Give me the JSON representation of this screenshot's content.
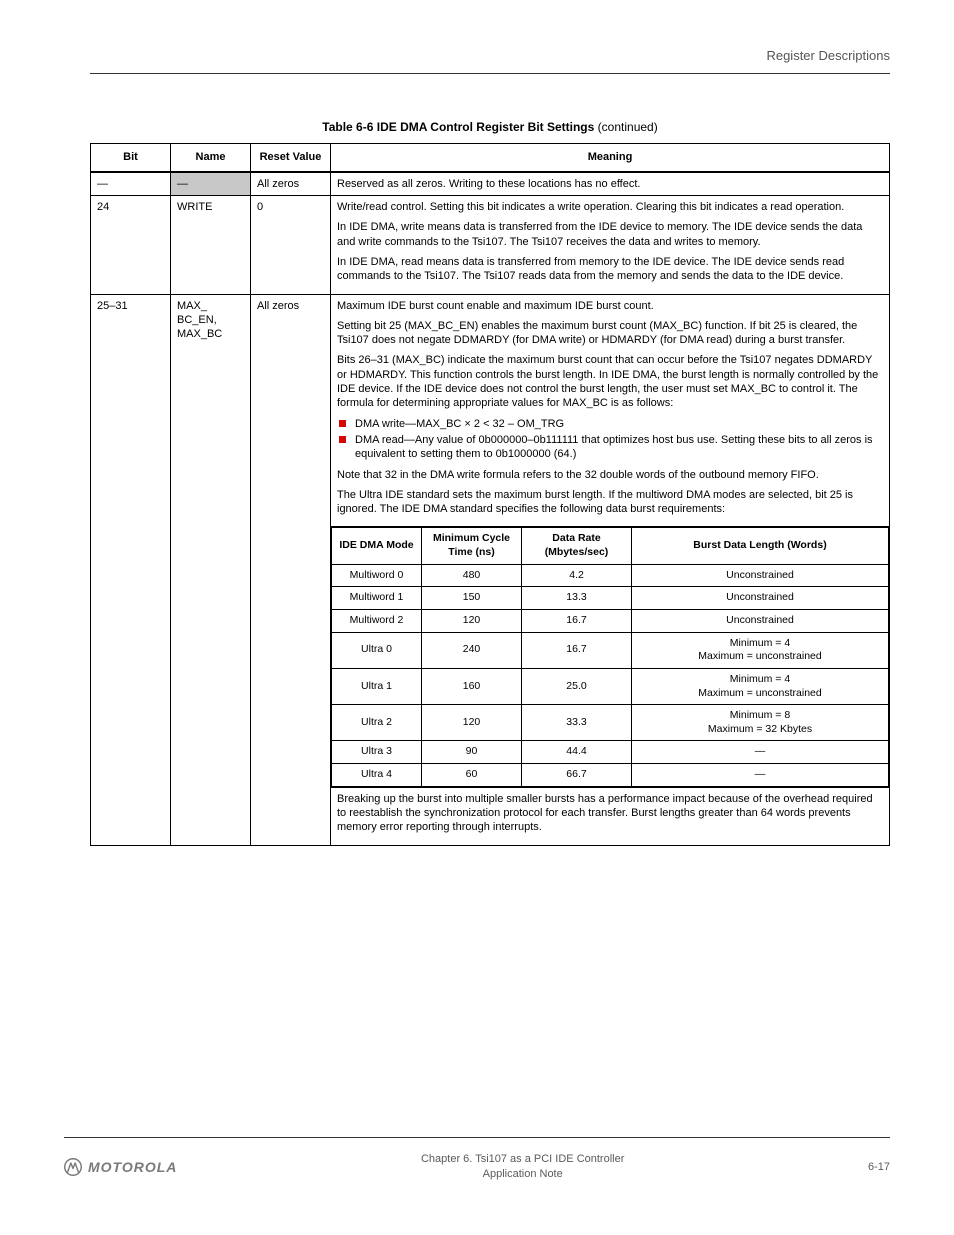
{
  "header": {
    "running": "Register Descriptions"
  },
  "caption": {
    "label": "Table 6-6",
    "title": "IDE DMA Control Register Bit Settings",
    "continued": "(continued)"
  },
  "columns": {
    "bit": "Bit",
    "name": "Name",
    "value": "Reset Value",
    "meaning": "Meaning"
  },
  "rows": [
    {
      "bit": "—",
      "name": "—",
      "name_shaded": true,
      "value": "All zeros",
      "meaning": "Reserved as all zeros. Writing to these locations has no effect.",
      "top_thick": true
    },
    {
      "bit": "24",
      "name": "WRITE",
      "value": "0",
      "meaning_html": [
        "Write/read control. Setting this bit indicates a write operation. Clearing this bit indicates a read operation.",
        "In IDE DMA, write means data is transferred from the IDE device to memory. The IDE device sends the data and write commands to the Tsi107. The Tsi107 receives the data and writes to memory.",
        "In IDE DMA, read means data is transferred from memory to the IDE device. The IDE device sends read commands to the Tsi107. The Tsi107 reads data from the memory and sends the data to the IDE device."
      ]
    }
  ],
  "big_row": {
    "bit": "25–31",
    "name": "MAX_\nBC_EN,\nMAX_BC",
    "value": "All zeros",
    "intro": [
      "Maximum IDE burst count enable and maximum IDE burst count.",
      "Setting bit 25 (MAX_BC_EN) enables the maximum burst count (MAX_BC) function. If bit 25 is cleared, the Tsi107 does not negate DDMARDY (for DMA write) or HDMARDY (for DMA read) during a burst transfer.",
      "Bits 26–31 (MAX_BC) indicate the maximum burst count that can occur before the Tsi107 negates DDMARDY or HDMARDY. This function controls the burst length. In IDE DMA, the burst length is normally controlled by the IDE device. If the IDE device does not control the burst length, the user must set MAX_BC to control it. The formula for determining appropriate values for MAX_BC is as follows:"
    ],
    "bullets": [
      "DMA write—MAX_BC × 2 < 32 – OM_TRG",
      "DMA read—Any value of 0b000000–0b111111 that optimizes host bus use. Setting these bits to all zeros is equivalent to setting them to 0b1000000 (64.)"
    ],
    "after_bullets": [
      "Note that 32 in the DMA write formula refers to the 32 double words of the outbound memory FIFO.",
      "The Ultra IDE standard sets the maximum burst length. If the multiword DMA modes are selected, bit 25 is ignored. The IDE DMA standard specifies the following data burst requirements:"
    ],
    "inner": {
      "headers": {
        "a": "IDE DMA Mode",
        "b": "Minimum Cycle Time (ns)",
        "c": "Data Rate (Mbytes/sec)",
        "d": "Burst Data Length (Words)"
      },
      "rows": [
        {
          "a": "Multiword 0",
          "b": "480",
          "c": "4.2",
          "d": "Unconstrained"
        },
        {
          "a": "Multiword 1",
          "b": "150",
          "c": "13.3",
          "d": "Unconstrained"
        },
        {
          "a": "Multiword 2",
          "b": "120",
          "c": "16.7",
          "d": "Unconstrained"
        },
        {
          "a": "Ultra 0",
          "b": "240",
          "c": "16.7",
          "d": "Minimum = 4\nMaximum = unconstrained"
        },
        {
          "a": "Ultra 1",
          "b": "160",
          "c": "25.0",
          "d": "Minimum = 4\nMaximum = unconstrained"
        },
        {
          "a": "Ultra 2",
          "b": "120",
          "c": "33.3",
          "d": "Minimum = 8\nMaximum = 32 Kbytes"
        },
        {
          "a": "Ultra 3",
          "b": "90",
          "c": "44.4",
          "d": "—"
        },
        {
          "a": "Ultra 4",
          "b": "60",
          "c": "66.7",
          "d": "—"
        }
      ]
    },
    "outro": "Breaking up the burst into multiple smaller bursts has a performance impact because of the overhead required to reestablish the synchronization protocol for each transfer. Burst lengths greater than 64 words prevents memory error reporting through interrupts."
  },
  "footer": {
    "brand": "MOTOROLA",
    "mid_a": "Chapter 6. Tsi107 as a PCI IDE Controller",
    "mid_b": "Application Note",
    "page": "6-17"
  }
}
